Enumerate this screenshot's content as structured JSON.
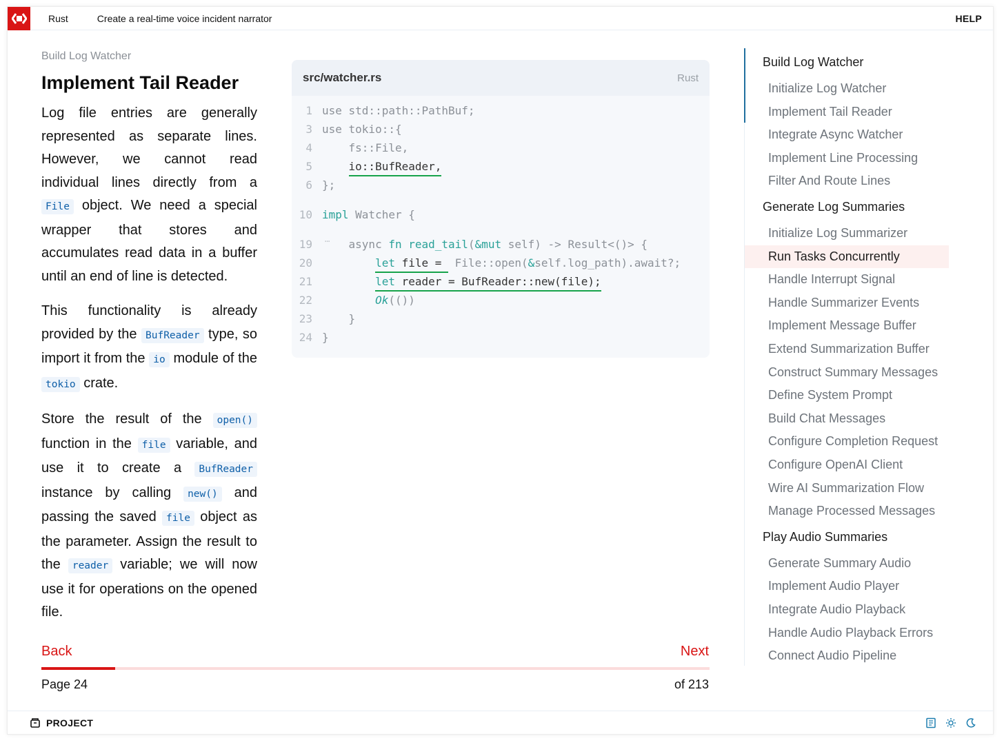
{
  "topbar": {
    "language": "Rust",
    "course_title": "Create a real-time voice incident narrator",
    "help": "HELP"
  },
  "lesson": {
    "breadcrumb": "Build Log Watcher",
    "title": "Implement Tail Reader",
    "p1": {
      "a": "Log file entries are generally represented as separate lines. However, we cannot read individual lines directly from a ",
      "code1": "File",
      "b": " object. We need a special wrapper that stores and accumulates read data in a buffer until an end of line is detected."
    },
    "p2": {
      "a": "This functionality is already provided by the ",
      "code1": "BufReader",
      "b": " type, so import it from the ",
      "code2": "io",
      "c": " module of the ",
      "code3": "tokio",
      "d": " crate."
    },
    "p3": {
      "a": "Store the result of the ",
      "code1": "open()",
      "b": " function in the ",
      "code2": "file",
      "c": " variable, and use it to create a ",
      "code3": "BufReader",
      "d": " instance by calling ",
      "code4": "new()",
      "e": " and passing the saved ",
      "code5": "file",
      "f": " object as the parameter. Assign the result to the ",
      "code6": "reader",
      "g": " variable; we will now use it for operations on the opened file."
    }
  },
  "code": {
    "filename": "src/watcher.rs",
    "language": "Rust",
    "line_numbers": [
      "1",
      "3",
      "4",
      "5",
      "6",
      "10",
      "19",
      "20",
      "21",
      "22",
      "23",
      "24"
    ]
  },
  "nav": {
    "back": "Back",
    "next": "Next",
    "page_label": "Page 24",
    "of_label": "of 213",
    "progress_fraction": 0.11
  },
  "toc": {
    "sections": [
      {
        "title": "Build Log Watcher",
        "items": [
          "Initialize Log Watcher",
          "Implement Tail Reader",
          "Integrate Async Watcher",
          "Implement Line Processing",
          "Filter And Route Lines"
        ]
      },
      {
        "title": "Generate Log Summaries",
        "items": [
          "Initialize Log Summarizer",
          "Run Tasks Concurrently",
          "Handle Interrupt Signal",
          "Handle Summarizer Events",
          "Implement Message Buffer",
          "Extend Summarization Buffer",
          "Construct Summary Messages",
          "Define System Prompt",
          "Build Chat Messages",
          "Configure Completion Request",
          "Configure OpenAI Client",
          "Wire AI Summarization Flow",
          "Manage Processed Messages"
        ]
      },
      {
        "title": "Play Audio Summaries",
        "items": [
          "Generate Summary Audio",
          "Implement Audio Player",
          "Integrate Audio Playback",
          "Handle Audio Playback Errors",
          "Connect Audio Pipeline"
        ]
      }
    ],
    "active_item": "Run Tasks Concurrently"
  },
  "bottombar": {
    "project": "PROJECT"
  },
  "colors": {
    "brand": "#d91515",
    "code_highlight": "#16a34a",
    "inline_code": "#0e5fa8"
  },
  "icons": [
    "logo-icon",
    "project-icon",
    "book-icon",
    "sun-icon",
    "moon-icon"
  ]
}
